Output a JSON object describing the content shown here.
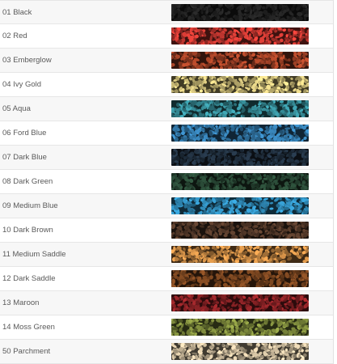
{
  "colors": [
    {
      "label": "01 Black",
      "hex": "#1f1f1f"
    },
    {
      "label": "02 Red",
      "hex": "#b2322c"
    },
    {
      "label": "03 Emberglow",
      "hex": "#8f3a22"
    },
    {
      "label": "04 Ivy Gold",
      "hex": "#b6a86b"
    },
    {
      "label": "05 Aqua",
      "hex": "#2f7a84"
    },
    {
      "label": "06 Ford Blue",
      "hex": "#2d6b96"
    },
    {
      "label": "07 Dark Blue",
      "hex": "#1e2c3a"
    },
    {
      "label": "08 Dark Green",
      "hex": "#24402f"
    },
    {
      "label": "09 Medium Blue",
      "hex": "#2a7aa2"
    },
    {
      "label": "10 Dark Brown",
      "hex": "#4b3325"
    },
    {
      "label": "11 Medium Saddle",
      "hex": "#b0793c"
    },
    {
      "label": "12 Dark Saddle",
      "hex": "#6b3d1c"
    },
    {
      "label": "13 Maroon",
      "hex": "#7d1f22"
    },
    {
      "label": "14 Moss Green",
      "hex": "#6f7a35"
    },
    {
      "label": "50 Parchment",
      "hex": "#b4a58a"
    }
  ]
}
